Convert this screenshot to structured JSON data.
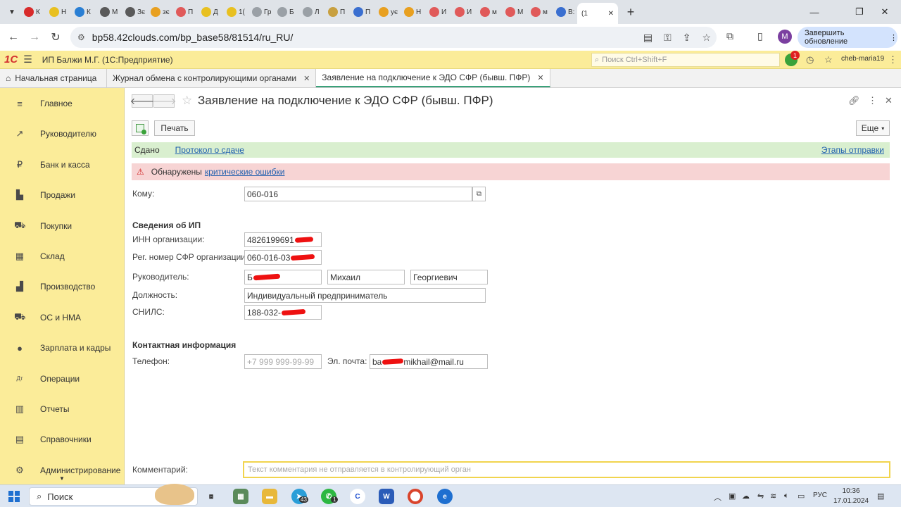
{
  "browser": {
    "tabs": [
      {
        "title": "К",
        "color": "#d82b2b"
      },
      {
        "title": "Н",
        "color": "#e8c020"
      },
      {
        "title": "К",
        "color": "#2a7fd4"
      },
      {
        "title": "М",
        "color": "#5a5a5a"
      },
      {
        "title": "Зє",
        "color": "#5a5a5a"
      },
      {
        "title": "зє",
        "color": "#e8a020"
      },
      {
        "title": "П",
        "color": "#e05a5a"
      },
      {
        "title": "Д",
        "color": "#e8c020"
      },
      {
        "title": "1(",
        "color": "#e8c020"
      },
      {
        "title": "Гр",
        "color": "#9aa0a6"
      },
      {
        "title": "Б",
        "color": "#9aa0a6"
      },
      {
        "title": "Л",
        "color": "#9aa0a6"
      },
      {
        "title": "П",
        "color": "#c8a040"
      },
      {
        "title": "П",
        "color": "#3a6fd0"
      },
      {
        "title": "ує",
        "color": "#e8a020"
      },
      {
        "title": "Н",
        "color": "#e8a020"
      },
      {
        "title": "И",
        "color": "#e05a5a"
      },
      {
        "title": "И",
        "color": "#e05a5a"
      },
      {
        "title": "м",
        "color": "#e05a5a"
      },
      {
        "title": "М",
        "color": "#e05a5a"
      },
      {
        "title": "м",
        "color": "#e05a5a"
      },
      {
        "title": "В:",
        "color": "#3a6fd0"
      }
    ],
    "active_tab": "(1",
    "url": "bp58.42clouds.com/bp_base58/81514/ru_RU/",
    "profile_initial": "M",
    "update_label": "Завершить обновление"
  },
  "app": {
    "logo": "1С",
    "title": "ИП Балжи М.Г.  (1С:Предприятие)",
    "search_placeholder": "Поиск Ctrl+Shift+F",
    "notification_count": "1",
    "user": "cheb-maria19"
  },
  "section_tabs": [
    {
      "label": "Начальная страница"
    },
    {
      "label": "Журнал обмена с контролирующими органами"
    },
    {
      "label": "Заявление на подключение к ЭДО СФР (бывш. ПФР)"
    }
  ],
  "sidebar": {
    "items": [
      {
        "label": "Главное",
        "icon": "≡"
      },
      {
        "label": "Руководителю",
        "icon": "↗"
      },
      {
        "label": "Банк и касса",
        "icon": "₽"
      },
      {
        "label": "Продажи",
        "icon": "▙"
      },
      {
        "label": "Покупки",
        "icon": "⛟"
      },
      {
        "label": "Склад",
        "icon": "▦"
      },
      {
        "label": "Производство",
        "icon": "▟"
      },
      {
        "label": "ОС и НМА",
        "icon": "⛟"
      },
      {
        "label": "Зарплата и кадры",
        "icon": "●"
      },
      {
        "label": "Операции",
        "icon": "Дт"
      },
      {
        "label": "Отчеты",
        "icon": "▥"
      },
      {
        "label": "Справочники",
        "icon": "▤"
      },
      {
        "label": "Администрирование",
        "icon": "⚙"
      }
    ]
  },
  "form": {
    "title": "Заявление на подключение к ЭДО СФР (бывш. ПФР)",
    "print_label": "Печать",
    "more_label": "Еще",
    "status": {
      "text": "Сдано",
      "protocol_link": "Протокол о сдаче",
      "stages_link": "Этапы отправки"
    },
    "error": {
      "text": "Обнаружены",
      "link": "критические ошибки"
    },
    "recipient": {
      "label": "Кому:",
      "value": "060-016"
    },
    "ip_section": {
      "heading": "Сведения об ИП",
      "inn_label": "ИНН организации:",
      "inn_value": "4826199691",
      "reg_label": "Рег. номер СФР организации:",
      "reg_value": "060-016-03",
      "head_label": "Руководитель:",
      "head_lastname": "Б",
      "head_firstname": "Михаил",
      "head_patronymic": "Георгиевич",
      "position_label": "Должность:",
      "position_value": "Индивидуальный предприниматель",
      "snils_label": "СНИЛС:",
      "snils_value": "188-032-"
    },
    "contacts": {
      "heading": "Контактная информация",
      "phone_label": "Телефон:",
      "phone_placeholder": "+7 999 999-99-99",
      "email_label": "Эл. почта:",
      "email_start": "ba",
      "email_end": "mikhail@mail.ru"
    },
    "comment": {
      "label": "Комментарий:",
      "placeholder": "Текст комментария не отправляется в контролирующий орган"
    }
  },
  "taskbar": {
    "search_label": "Поиск",
    "tray_lang": "РУС",
    "time": "10:36",
    "date": "17.01.2024",
    "telegram_badge": "43",
    "whatsapp_badge": "1"
  }
}
